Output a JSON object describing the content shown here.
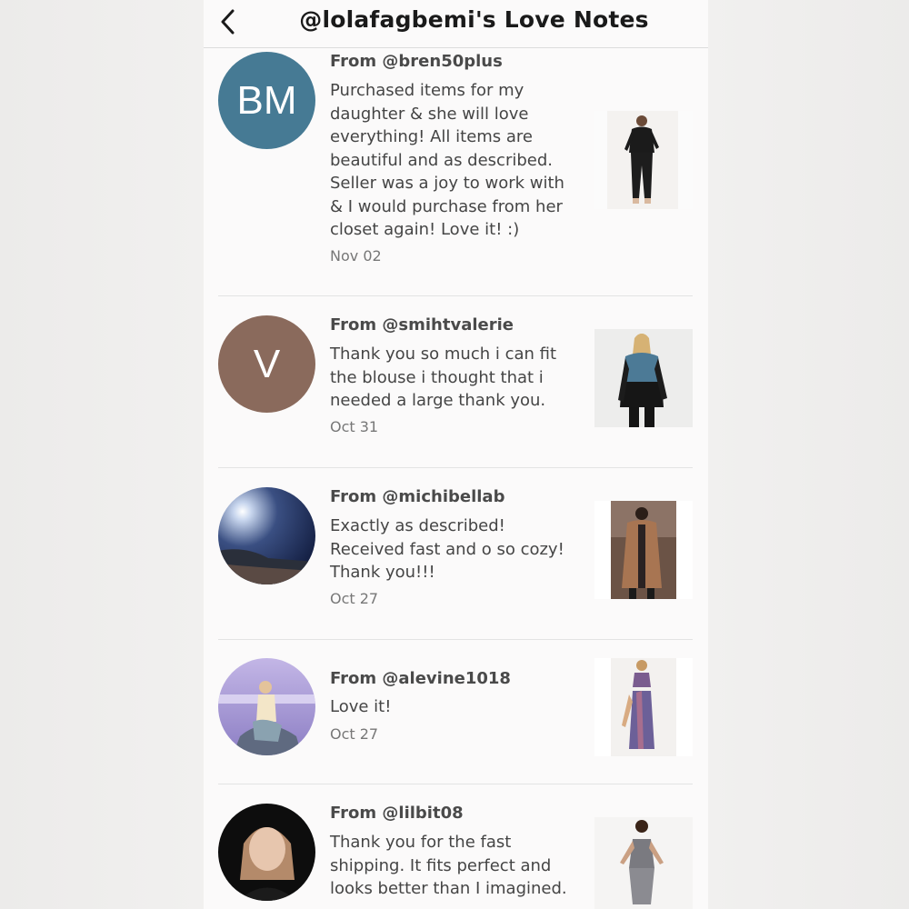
{
  "header": {
    "title": "@lolafagbemi's Love Notes"
  },
  "notes": [
    {
      "from": "From @bren50plus",
      "avatar_initials": "BM",
      "avatar_color": "#467a94",
      "message": "Purchased items for my daughter & she will love everything! All items are beautiful and as described. Seller was a joy to work with & I would purchase from her closet again! Love it! :)",
      "date": "Nov 02"
    },
    {
      "from": "From @smihtvalerie",
      "avatar_initials": "V",
      "avatar_color": "#8a6a5c",
      "message": "Thank you so much i can fit the blouse i thought that i needed a large thank you.",
      "date": "Oct 31"
    },
    {
      "from": "From @michibellab",
      "message": "Exactly as described! Received fast and o so cozy! Thank you!!!",
      "date": "Oct 27"
    },
    {
      "from": "From @alevine1018",
      "message": "Love it!",
      "date": "Oct 27"
    },
    {
      "from": "From @lilbit08",
      "message": "Thank you for the fast shipping. It fits perfect and looks better than I imagined.",
      "date": ""
    }
  ]
}
